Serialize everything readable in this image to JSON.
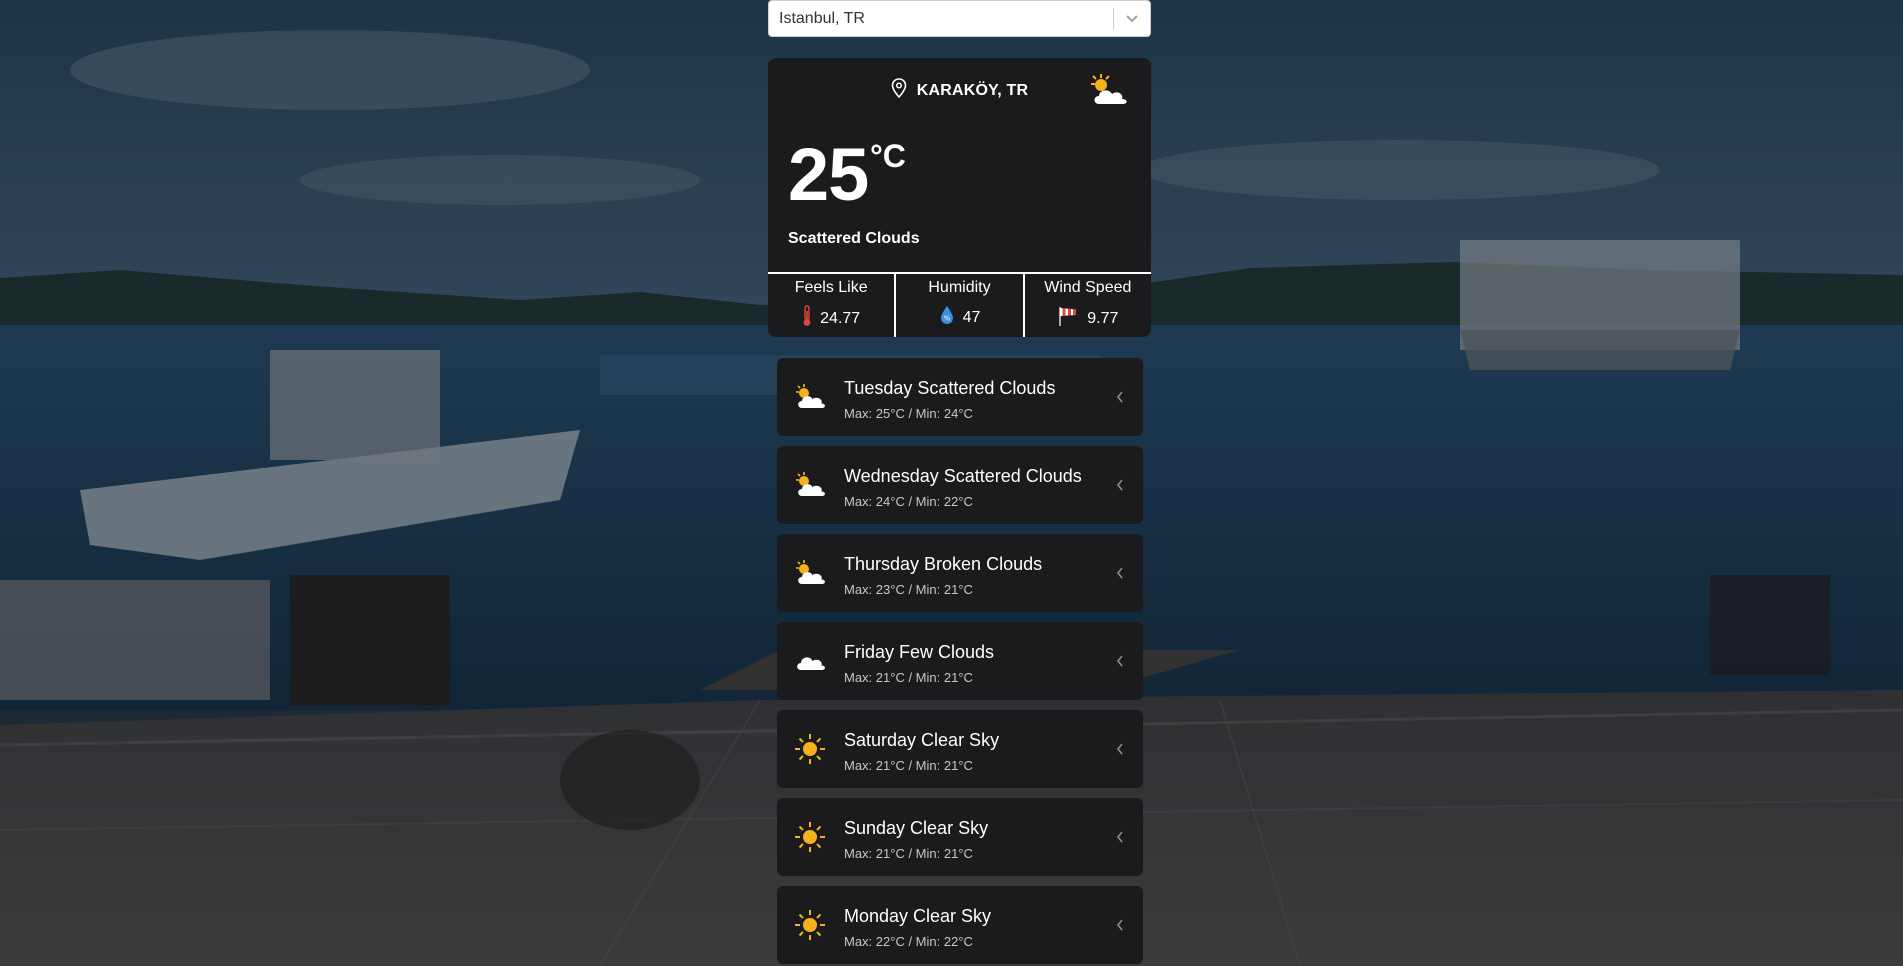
{
  "search": {
    "selected": "Istanbul, TR"
  },
  "current": {
    "location": "KARAKÖY, TR",
    "temperature": "25",
    "unit": "°C",
    "description": "Scattered Clouds",
    "icon": "partly-cloudy-icon",
    "stats": [
      {
        "label": "Feels Like",
        "value": "24.77",
        "icon": "thermometer-icon"
      },
      {
        "label": "Humidity",
        "value": "47",
        "icon": "humidity-icon"
      },
      {
        "label": "Wind Speed",
        "value": "9.77",
        "icon": "windsock-icon"
      }
    ]
  },
  "forecast": [
    {
      "title": "Tuesday Scattered Clouds",
      "sub": "Max: 25°C / Min: 24°C",
      "icon": "partly-cloudy-icon"
    },
    {
      "title": "Wednesday Scattered Clouds",
      "sub": "Max: 24°C / Min: 22°C",
      "icon": "partly-cloudy-icon"
    },
    {
      "title": "Thursday Broken Clouds",
      "sub": "Max: 23°C / Min: 21°C",
      "icon": "partly-cloudy-icon"
    },
    {
      "title": "Friday Few Clouds",
      "sub": "Max: 21°C / Min: 21°C",
      "icon": "cloud-icon"
    },
    {
      "title": "Saturday Clear Sky",
      "sub": "Max: 21°C / Min: 21°C",
      "icon": "sun-icon"
    },
    {
      "title": "Sunday Clear Sky",
      "sub": "Max: 21°C / Min: 21°C",
      "icon": "sun-icon"
    },
    {
      "title": "Monday Clear Sky",
      "sub": "Max: 22°C / Min: 22°C",
      "icon": "sun-icon"
    }
  ],
  "colors": {
    "card": "#1b1a1d",
    "sun": "#f5b21c",
    "thermometer": "#e0483c",
    "droplet": "#3b8ee0"
  }
}
